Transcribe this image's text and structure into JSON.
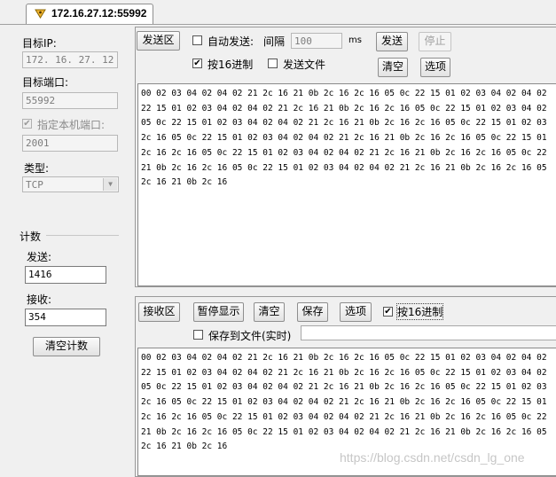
{
  "tab": {
    "title": "172.16.27.12:55992",
    "icon": "connection-icon"
  },
  "left_panel": {
    "target_ip_label": "目标IP:",
    "target_ip_value": "172. 16. 27. 12",
    "target_port_label": "目标端口:",
    "target_port_value": "55992",
    "local_port_checkbox_label": "指定本机端口:",
    "local_port_value": "2001",
    "type_label": "类型:",
    "type_value": "TCP",
    "counter_group_label": "计数",
    "sent_label": "发送:",
    "sent_value": "1416",
    "received_label": "接收:",
    "received_value": "354",
    "clear_counter_button": "清空计数"
  },
  "send_area": {
    "title_button": "发送区",
    "auto_send_label": "自动发送:",
    "interval_label": "间隔",
    "interval_value": "100",
    "interval_unit": "ms",
    "send_button": "发送",
    "stop_button": "停止",
    "hex_checkbox_label": "按16进制",
    "hex_checked": true,
    "send_file_label": "发送文件",
    "clear_button": "清空",
    "options_button": "选项",
    "hex_lines": [
      "00 02 03 04 02 04 02 21 2c 16 21 0b 2c 16 2c 16 05 0c 22 15 01 02 03 04 02 04 02",
      "22 15 01 02 03 04 02 04 02 21 2c 16 21 0b 2c 16 2c 16 05 0c 22 15 01 02 03 04 02",
      "05 0c 22 15 01 02 03 04 02 04 02 21 2c 16 21 0b 2c 16 2c 16 05 0c 22 15 01 02 03",
      "2c 16 05 0c 22 15 01 02 03 04 02 04 02 21 2c 16 21 0b 2c 16 2c 16 05 0c 22 15 01",
      "2c 16 2c 16 05 0c 22 15 01 02 03 04 02 04 02 21 2c 16 21 0b 2c 16 2c 16 05 0c 22",
      "21 0b 2c 16 2c 16 05 0c 22 15 01 02 03 04 02 04 02 21 2c 16 21 0b 2c 16 2c 16 05",
      "2c 16 21 0b 2c 16"
    ]
  },
  "receive_area": {
    "title_button": "接收区",
    "pause_button": "暂停显示",
    "clear_button": "清空",
    "save_button": "保存",
    "options_button": "选项",
    "hex_checkbox_label": "按16进制",
    "hex_checked": true,
    "save_to_file_label": "保存到文件(实时)",
    "save_path_value": "",
    "hex_lines": [
      "00 02 03 04 02 04 02 21 2c 16 21 0b 2c 16 2c 16 05 0c 22 15 01 02 03 04 02 04 02",
      "22 15 01 02 03 04 02 04 02 21 2c 16 21 0b 2c 16 2c 16 05 0c 22 15 01 02 03 04 02",
      "05 0c 22 15 01 02 03 04 02 04 02 21 2c 16 21 0b 2c 16 2c 16 05 0c 22 15 01 02 03",
      "2c 16 05 0c 22 15 01 02 03 04 02 04 02 21 2c 16 21 0b 2c 16 2c 16 05 0c 22 15 01",
      "2c 16 2c 16 05 0c 22 15 01 02 03 04 02 04 02 21 2c 16 21 0b 2c 16 2c 16 05 0c 22",
      "21 0b 2c 16 2c 16 05 0c 22 15 01 02 03 04 02 04 02 21 2c 16 21 0b 2c 16 2c 16 05",
      "2c 16 21 0b 2c 16"
    ]
  },
  "watermark": "https://blog.csdn.net/csdn_lg_one"
}
